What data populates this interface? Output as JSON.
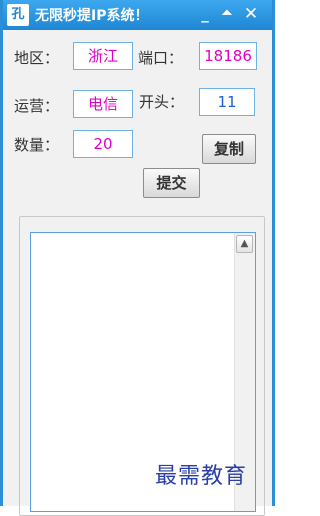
{
  "window": {
    "title": "无限秒提IP系统！",
    "icon_glyph": "孔",
    "minimize_glyph": "_",
    "maximize_glyph": "⏶",
    "close_glyph": "✕",
    "accent_color": "#2a8fd7"
  },
  "form": {
    "region_label": "地区：",
    "region_value": "浙江",
    "port_label": "端口：",
    "port_value": "18186",
    "carrier_label": "运营：",
    "carrier_value": "电信",
    "prefix_label": "开头：",
    "prefix_value": "11",
    "count_label": "数量：",
    "count_value": "20",
    "value_color": "#e000c8"
  },
  "buttons": {
    "copy_label": "复制",
    "submit_label": "提交"
  },
  "output": {
    "text": "",
    "scroll_up_glyph": "▲"
  },
  "watermark": {
    "text": "最需教育"
  }
}
